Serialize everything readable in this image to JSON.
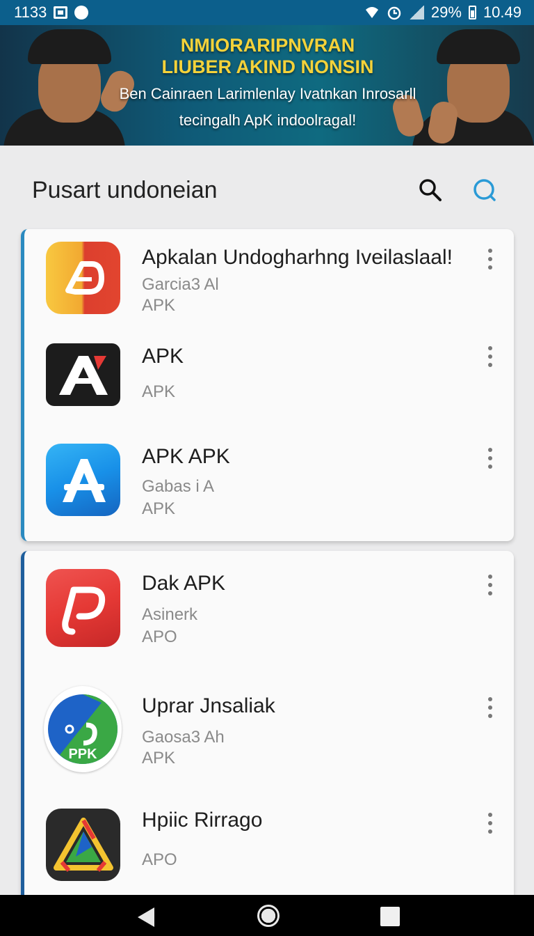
{
  "status_bar": {
    "left_time": "1133",
    "right_battery_text": "%",
    "right_battery_pct": "29",
    "clock": "10.49",
    "icons": [
      "gallery-icon",
      "messenger-icon",
      "wifi-icon",
      "alarm-icon",
      "signal-icon",
      "battery-icon"
    ]
  },
  "banner": {
    "title_line1": "NMIORARIPNVRAN",
    "title_line2": "LIUBER AKIND NONSIN",
    "subtitle_line1": "Ben Cainraen Larimlenlay Ivatnkan Inrosarll",
    "subtitle_line2": "tecingalh ApK indoolragal!"
  },
  "header": {
    "title": "Pusart undoneian",
    "search_icon": "search-icon",
    "secondary_search_icon": "search-circle-icon",
    "accent_color": "#2a8ac0"
  },
  "apps": [
    {
      "name": "Apkalan Undogharhng Iveilaslaal!",
      "developer": "Garcia3 Al",
      "type": "APK",
      "icon": "orange-d-app-icon",
      "colors": [
        "#f6c235",
        "#d9382a"
      ]
    },
    {
      "name": "APK",
      "developer": "",
      "type": "APK",
      "icon": "black-a-app-icon",
      "colors": [
        "#1b1b1b",
        "#e53935"
      ]
    },
    {
      "name": "APK APK",
      "developer": "Gabas i A",
      "type": "APK",
      "icon": "blue-a-app-icon",
      "colors": [
        "#1ea0ef",
        "#1565c0"
      ]
    },
    {
      "name": "Dak APK",
      "developer": "Asinerk",
      "type": "APO",
      "icon": "red-p-app-icon",
      "colors": [
        "#e53935",
        "#c62828"
      ]
    },
    {
      "name": "Uprar Jnsaliak",
      "developer": "Gaosa3 Ah",
      "type": "APK",
      "icon": "ppk-app-icon",
      "colors": [
        "#1e63c7",
        "#3aa845"
      ]
    },
    {
      "name": "Hpiic Rirrago",
      "developer": "",
      "type": "APO",
      "icon": "triangle-app-icon",
      "colors": [
        "#2a2a2a",
        "#f4c330"
      ]
    }
  ],
  "nav": {
    "back_icon": "back-icon",
    "home_icon": "home-icon",
    "recents_icon": "recents-icon"
  }
}
